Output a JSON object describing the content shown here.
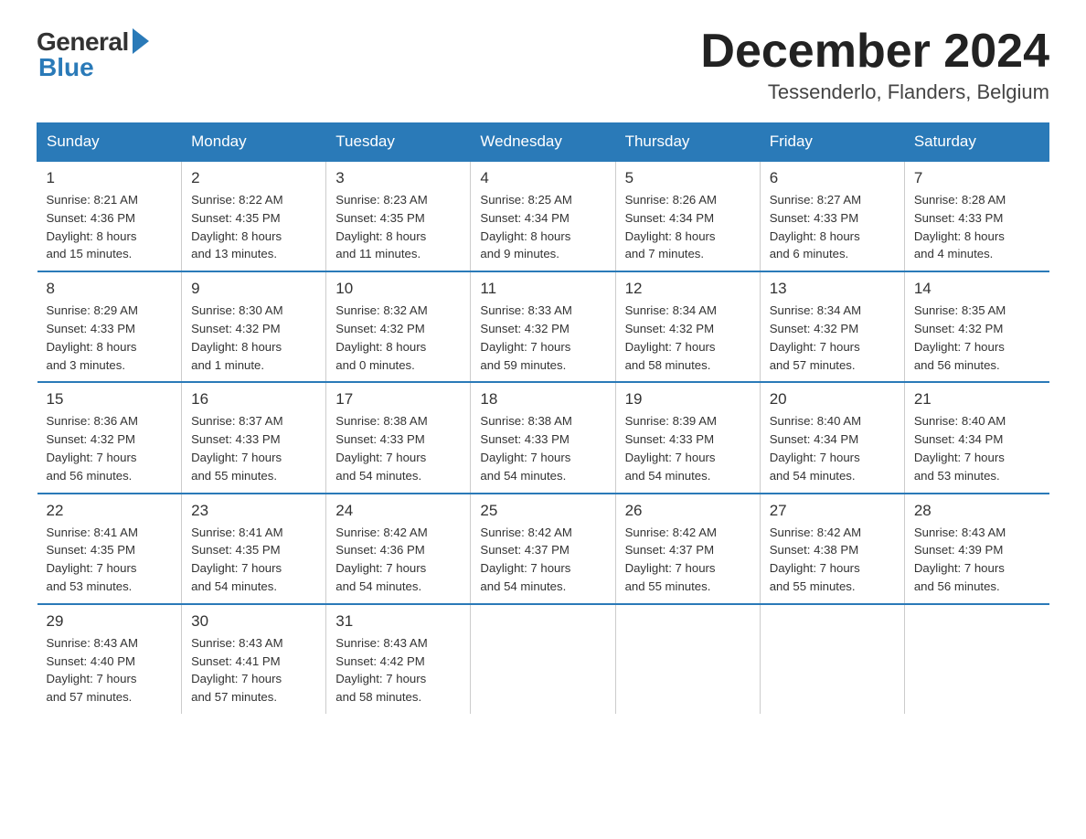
{
  "logo": {
    "general": "General",
    "blue": "Blue"
  },
  "title": "December 2024",
  "subtitle": "Tessenderlo, Flanders, Belgium",
  "days_of_week": [
    "Sunday",
    "Monday",
    "Tuesday",
    "Wednesday",
    "Thursday",
    "Friday",
    "Saturday"
  ],
  "weeks": [
    [
      {
        "day": "1",
        "info": "Sunrise: 8:21 AM\nSunset: 4:36 PM\nDaylight: 8 hours\nand 15 minutes."
      },
      {
        "day": "2",
        "info": "Sunrise: 8:22 AM\nSunset: 4:35 PM\nDaylight: 8 hours\nand 13 minutes."
      },
      {
        "day": "3",
        "info": "Sunrise: 8:23 AM\nSunset: 4:35 PM\nDaylight: 8 hours\nand 11 minutes."
      },
      {
        "day": "4",
        "info": "Sunrise: 8:25 AM\nSunset: 4:34 PM\nDaylight: 8 hours\nand 9 minutes."
      },
      {
        "day": "5",
        "info": "Sunrise: 8:26 AM\nSunset: 4:34 PM\nDaylight: 8 hours\nand 7 minutes."
      },
      {
        "day": "6",
        "info": "Sunrise: 8:27 AM\nSunset: 4:33 PM\nDaylight: 8 hours\nand 6 minutes."
      },
      {
        "day": "7",
        "info": "Sunrise: 8:28 AM\nSunset: 4:33 PM\nDaylight: 8 hours\nand 4 minutes."
      }
    ],
    [
      {
        "day": "8",
        "info": "Sunrise: 8:29 AM\nSunset: 4:33 PM\nDaylight: 8 hours\nand 3 minutes."
      },
      {
        "day": "9",
        "info": "Sunrise: 8:30 AM\nSunset: 4:32 PM\nDaylight: 8 hours\nand 1 minute."
      },
      {
        "day": "10",
        "info": "Sunrise: 8:32 AM\nSunset: 4:32 PM\nDaylight: 8 hours\nand 0 minutes."
      },
      {
        "day": "11",
        "info": "Sunrise: 8:33 AM\nSunset: 4:32 PM\nDaylight: 7 hours\nand 59 minutes."
      },
      {
        "day": "12",
        "info": "Sunrise: 8:34 AM\nSunset: 4:32 PM\nDaylight: 7 hours\nand 58 minutes."
      },
      {
        "day": "13",
        "info": "Sunrise: 8:34 AM\nSunset: 4:32 PM\nDaylight: 7 hours\nand 57 minutes."
      },
      {
        "day": "14",
        "info": "Sunrise: 8:35 AM\nSunset: 4:32 PM\nDaylight: 7 hours\nand 56 minutes."
      }
    ],
    [
      {
        "day": "15",
        "info": "Sunrise: 8:36 AM\nSunset: 4:32 PM\nDaylight: 7 hours\nand 56 minutes."
      },
      {
        "day": "16",
        "info": "Sunrise: 8:37 AM\nSunset: 4:33 PM\nDaylight: 7 hours\nand 55 minutes."
      },
      {
        "day": "17",
        "info": "Sunrise: 8:38 AM\nSunset: 4:33 PM\nDaylight: 7 hours\nand 54 minutes."
      },
      {
        "day": "18",
        "info": "Sunrise: 8:38 AM\nSunset: 4:33 PM\nDaylight: 7 hours\nand 54 minutes."
      },
      {
        "day": "19",
        "info": "Sunrise: 8:39 AM\nSunset: 4:33 PM\nDaylight: 7 hours\nand 54 minutes."
      },
      {
        "day": "20",
        "info": "Sunrise: 8:40 AM\nSunset: 4:34 PM\nDaylight: 7 hours\nand 54 minutes."
      },
      {
        "day": "21",
        "info": "Sunrise: 8:40 AM\nSunset: 4:34 PM\nDaylight: 7 hours\nand 53 minutes."
      }
    ],
    [
      {
        "day": "22",
        "info": "Sunrise: 8:41 AM\nSunset: 4:35 PM\nDaylight: 7 hours\nand 53 minutes."
      },
      {
        "day": "23",
        "info": "Sunrise: 8:41 AM\nSunset: 4:35 PM\nDaylight: 7 hours\nand 54 minutes."
      },
      {
        "day": "24",
        "info": "Sunrise: 8:42 AM\nSunset: 4:36 PM\nDaylight: 7 hours\nand 54 minutes."
      },
      {
        "day": "25",
        "info": "Sunrise: 8:42 AM\nSunset: 4:37 PM\nDaylight: 7 hours\nand 54 minutes."
      },
      {
        "day": "26",
        "info": "Sunrise: 8:42 AM\nSunset: 4:37 PM\nDaylight: 7 hours\nand 55 minutes."
      },
      {
        "day": "27",
        "info": "Sunrise: 8:42 AM\nSunset: 4:38 PM\nDaylight: 7 hours\nand 55 minutes."
      },
      {
        "day": "28",
        "info": "Sunrise: 8:43 AM\nSunset: 4:39 PM\nDaylight: 7 hours\nand 56 minutes."
      }
    ],
    [
      {
        "day": "29",
        "info": "Sunrise: 8:43 AM\nSunset: 4:40 PM\nDaylight: 7 hours\nand 57 minutes."
      },
      {
        "day": "30",
        "info": "Sunrise: 8:43 AM\nSunset: 4:41 PM\nDaylight: 7 hours\nand 57 minutes."
      },
      {
        "day": "31",
        "info": "Sunrise: 8:43 AM\nSunset: 4:42 PM\nDaylight: 7 hours\nand 58 minutes."
      },
      {
        "day": "",
        "info": ""
      },
      {
        "day": "",
        "info": ""
      },
      {
        "day": "",
        "info": ""
      },
      {
        "day": "",
        "info": ""
      }
    ]
  ]
}
